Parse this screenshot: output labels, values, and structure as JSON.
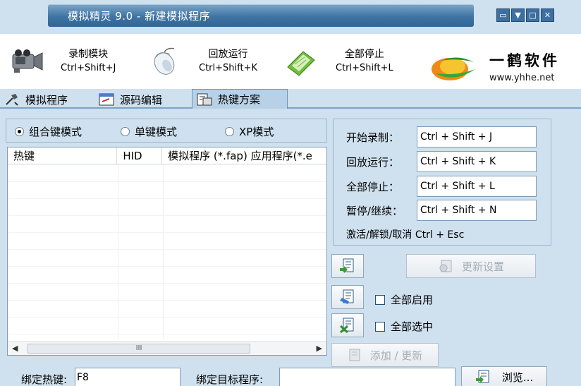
{
  "window": {
    "title": "模拟精灵 9.0 - 新建模拟程序",
    "buttons": [
      "restore-icon",
      "minimize-icon",
      "maximize-icon",
      "close-icon"
    ]
  },
  "toolbar": {
    "items": [
      {
        "label": "录制模块",
        "shortcut": "Ctrl+Shift+J",
        "icon": "camcorder-icon"
      },
      {
        "label": "回放运行",
        "shortcut": "Ctrl+Shift+K",
        "icon": "mouse-icon"
      },
      {
        "label": "全部停止",
        "shortcut": "Ctrl+Shift+L",
        "icon": "stop-card-icon"
      }
    ],
    "logo_cn": "一鹤软件",
    "logo_url": "www.yhhe.net"
  },
  "tabs": [
    {
      "label": "模拟程序",
      "icon": "hammer-icon",
      "active": false
    },
    {
      "label": "源码编辑",
      "icon": "code-edit-icon",
      "active": false
    },
    {
      "label": "热键方案",
      "icon": "hotkey-icon",
      "active": true
    }
  ],
  "mode": {
    "options": [
      "组合键模式",
      "单键模式",
      "XP模式"
    ],
    "selected": "组合键模式"
  },
  "hotkey_list": {
    "columns": [
      "热键",
      "HID",
      "模拟程序 (*.fap) 应用程序(*.e"
    ],
    "rows": [],
    "scroll_grip": "III"
  },
  "hotkeys": {
    "rows": [
      {
        "label": "开始录制：",
        "value": "Ctrl + Shift + J"
      },
      {
        "label": "回放运行：",
        "value": "Ctrl + Shift + K"
      },
      {
        "label": "全部停止：",
        "value": "Ctrl + Shift + L"
      },
      {
        "label": "暂停/继续：",
        "value": "Ctrl + Shift + N"
      }
    ],
    "note": "激活/解锁/取消 Ctrl + Esc"
  },
  "actions": {
    "update_settings": "更新设置",
    "enable_all": "全部启用",
    "select_all": "全部选中",
    "add_update": "添加 / 更新",
    "browse": "浏览..."
  },
  "bottom": {
    "bind_hotkey_label": "绑定热键:",
    "bind_hotkey_value": "F8",
    "bind_target_label": "绑定目标程序:",
    "bind_target_value": ""
  }
}
